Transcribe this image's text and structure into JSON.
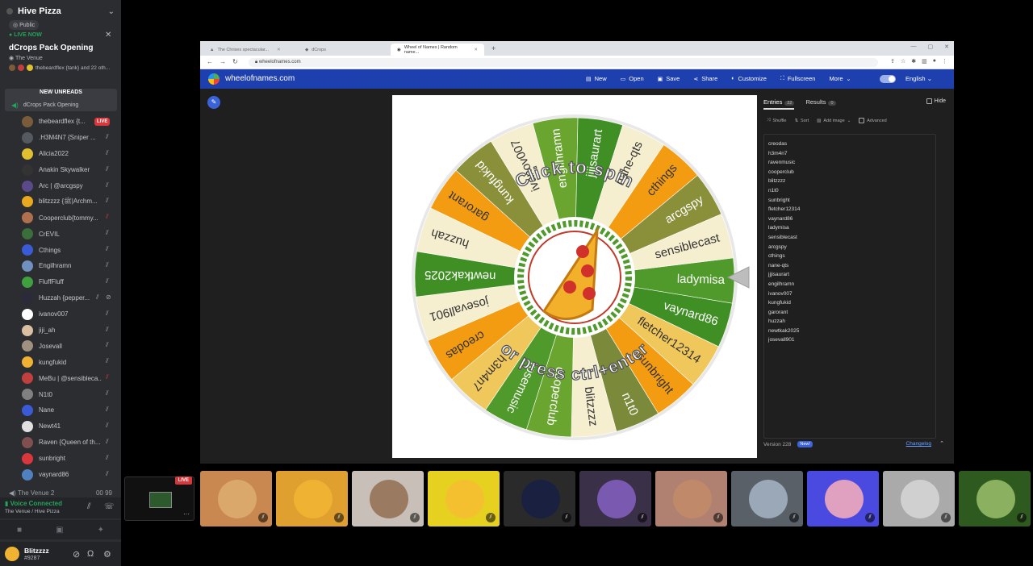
{
  "sidebar": {
    "server_name": "Hive Pizza",
    "public_label": "Public",
    "live_now_label": "LIVE NOW",
    "event_title": "dCrops Pack Opening",
    "event_venue": "The Venue",
    "event_people": "thebeardflex {tank} and 22 oth...",
    "new_unreads_label": "NEW UNREADS",
    "unread_channel": "dCrops Pack Opening",
    "members": [
      {
        "name": "thebeardflex {t...",
        "live": "LIVE",
        "color": "#7a5c3a"
      },
      {
        "name": ".H3M4N7 {Sniper ...",
        "color": "#555a60"
      },
      {
        "name": "Alicia2022",
        "color": "#e0c030"
      },
      {
        "name": "Anakin Skywalker",
        "color": "#333333"
      },
      {
        "name": "Arc | @arcgspy",
        "color": "#5b4a8a"
      },
      {
        "name": "blitzzzz {ﷺ|Archm...",
        "color": "#e8a820"
      },
      {
        "name": "Cooperclub{tommy...",
        "color": "#b07050",
        "muted": "red"
      },
      {
        "name": "CrEVIL",
        "color": "#3a6e3a"
      },
      {
        "name": "Cthings",
        "color": "#3b5bd6"
      },
      {
        "name": "Engilhramn",
        "color": "#7090c0"
      },
      {
        "name": "FluffFluff",
        "color": "#40a040"
      },
      {
        "name": "Huzzah {pepper...",
        "color": "#2a2a3a",
        "extra": true
      },
      {
        "name": "ivanov007",
        "color": "#ffffff"
      },
      {
        "name": "jiji_ah",
        "color": "#d8c0a0"
      },
      {
        "name": "Josevall",
        "color": "#a09080"
      },
      {
        "name": "kungfukid",
        "color": "#f0b232"
      },
      {
        "name": "MeBu | @sensibleca...",
        "color": "#c04040",
        "muted": "red"
      },
      {
        "name": "N1t0",
        "color": "#808080"
      },
      {
        "name": "Nane",
        "color": "#3b5bd6"
      },
      {
        "name": "Newt41",
        "color": "#e0e0e0"
      },
      {
        "name": "Raven {Queen of th...",
        "color": "#805050"
      },
      {
        "name": "sunbright",
        "color": "#da373c"
      },
      {
        "name": "vaynard86",
        "color": "#5080c0"
      }
    ],
    "venue2_label": "The Venue 2",
    "venue2_count": "00  99",
    "voice_connected": "Voice Connected",
    "voice_location": "The Venue / Hive Pizza",
    "user_name": "Blitzzzz",
    "user_tag": "#9287"
  },
  "browser": {
    "tabs": [
      {
        "label": "The Chrises spectacular...",
        "active": false
      },
      {
        "label": "dCrops",
        "active": false
      },
      {
        "label": "Wheel of Names | Random name...",
        "active": true
      }
    ],
    "url": "wheelofnames.com",
    "site_name": "wheelofnames.com",
    "menu": [
      {
        "icon": "file-icon",
        "label": "New"
      },
      {
        "icon": "folder-icon",
        "label": "Open"
      },
      {
        "icon": "save-icon",
        "label": "Save"
      },
      {
        "icon": "share-icon",
        "label": "Share"
      },
      {
        "icon": "palette-icon",
        "label": "Customize"
      },
      {
        "icon": "fullscreen-icon",
        "label": "Fullscreen"
      },
      {
        "icon": "chevron-down-icon",
        "label": "More"
      }
    ],
    "language": "English"
  },
  "wheel": {
    "top_text": "Click to spin",
    "bottom_text": "or press ctrl+enter",
    "segments": [
      "ladymisa",
      "vaynard86",
      "fletcher12314",
      "sunbright",
      "n1t0",
      "blitzzzz",
      "cooperclub",
      "rosemusic",
      "h3m4n7",
      "creodas",
      "josevall901",
      "newtkak2025",
      "huzzah",
      "garorant",
      "kungfukid",
      "ivanov007",
      "engilhramn",
      "jjjisaurart",
      "nane-qts",
      "cthings",
      "arcgspy",
      "sensiblecast"
    ],
    "colors": [
      "#4f9a2a",
      "#3f8f24",
      "#f0c75a",
      "#f39c12",
      "#7a8a3a",
      "#f5efcf",
      "#6aa52f",
      "#4f9a2a",
      "#f0c75a",
      "#f39c12",
      "#f5efcf",
      "#3f8f24",
      "#f5efcf",
      "#f39c12",
      "#8a8f3a",
      "#f5efcf",
      "#6aa52f",
      "#3f8f24",
      "#f5efcf",
      "#f39c12",
      "#8a8f3a",
      "#f5efcf"
    ]
  },
  "entries_panel": {
    "tab_entries": "Entries",
    "entries_count": "22",
    "tab_results": "Results",
    "results_count": "0",
    "hide_label": "Hide",
    "shuffle_label": "Shuffle",
    "sort_label": "Sort",
    "add_image_label": "Add image",
    "advanced_label": "Advanced",
    "entries": [
      "creodas",
      "h3m4n7",
      "ravenmusic",
      "cooperclub",
      "blitzzzz",
      "n1t0",
      "sunbright",
      "fletcher12314",
      "vaynard86",
      "ladymisa",
      "sensiblecast",
      "arcgspy",
      "cthings",
      "nane-qts",
      "jjjisaurart",
      "engilhramn",
      "ivanov007",
      "kungfukid",
      "garorant",
      "huzzah",
      "newtkak2025",
      "josevall901"
    ],
    "version": "Version 228",
    "new_badge": "New!",
    "changelog": "Changelog"
  },
  "tiles": [
    {
      "bg": "#c8884f",
      "avatar": "#d9a86a"
    },
    {
      "bg": "#e0a030",
      "avatar": "#f0b232"
    },
    {
      "bg": "#c8c0b8",
      "avatar": "#9a7a60"
    },
    {
      "bg": "#e6d020",
      "avatar": "#f5c030"
    },
    {
      "bg": "#2a2a2a",
      "avatar": "#1a2040"
    },
    {
      "bg": "#3a3048",
      "avatar": "#7a5ab0"
    },
    {
      "bg": "#b08070",
      "avatar": "#c08a6a"
    },
    {
      "bg": "#5a6068",
      "avatar": "#9aa8b8"
    },
    {
      "bg": "#4a4ae0",
      "avatar": "#e0a0c0"
    },
    {
      "bg": "#aaaaaa",
      "avatar": "#d0d0d0"
    },
    {
      "bg": "#2e5a20",
      "avatar": "#8ab060"
    }
  ],
  "self_tile_live": "LIVE"
}
